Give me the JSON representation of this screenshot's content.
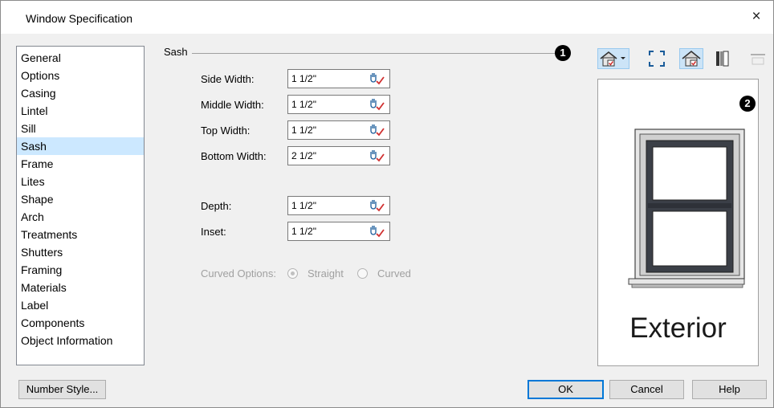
{
  "window": {
    "title": "Window Specification",
    "close_glyph": "×"
  },
  "nav": {
    "items": [
      "General",
      "Options",
      "Casing",
      "Lintel",
      "Sill",
      "Sash",
      "Frame",
      "Lites",
      "Shape",
      "Arch",
      "Treatments",
      "Shutters",
      "Framing",
      "Materials",
      "Label",
      "Components",
      "Object Information"
    ],
    "selected": "Sash"
  },
  "sash": {
    "group_label": "Sash",
    "fields": [
      {
        "label": "Side Width:",
        "value": "1 1/2\""
      },
      {
        "label": "Middle Width:",
        "value": "1 1/2\""
      },
      {
        "label": "Top Width:",
        "value": "1 1/2\""
      },
      {
        "label": "Bottom Width:",
        "value": "2 1/2\""
      },
      {
        "label": "Depth:",
        "value": "1 1/2\""
      },
      {
        "label": "Inset:",
        "value": "1 1/2\""
      }
    ],
    "field_icon": "dimension-edit-icon",
    "curved_options": {
      "label": "Curved Options:",
      "options": [
        "Straight",
        "Curved"
      ],
      "selected": "Straight",
      "disabled": true
    }
  },
  "callouts": [
    "1",
    "2"
  ],
  "toolbar": {
    "icons": [
      "house-view-dropdown-icon",
      "fit-to-window-icon",
      "show-preview-icon",
      "frame-view-icon",
      "disabled-toggle-icon"
    ]
  },
  "preview": {
    "label": "Exterior"
  },
  "buttons": {
    "number_style": "Number Style...",
    "ok": "OK",
    "cancel": "Cancel",
    "help": "Help"
  },
  "colors": {
    "selection": "#cce8ff",
    "accent": "#0078d7",
    "edit_check": "#d03030"
  }
}
